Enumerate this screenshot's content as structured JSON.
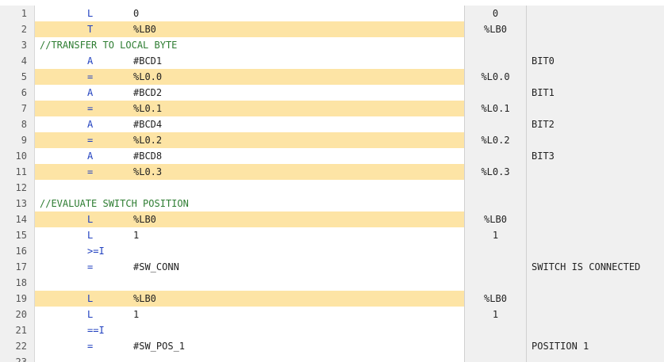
{
  "colors": {
    "keyword": "#1f3fbf",
    "number": "#3a6fd8",
    "comment": "#2e7d32",
    "highlight": "#fde4a5",
    "panel": "#f0f0f0"
  },
  "lines": [
    {
      "n": "1",
      "type": "code",
      "instr": "L",
      "operand": "0",
      "operandType": "num",
      "col2": "0",
      "col3": "",
      "hl": false
    },
    {
      "n": "2",
      "type": "code",
      "instr": "T",
      "operand": "%LB0",
      "operandType": "text",
      "col2": "%LB0",
      "col3": "",
      "hl": true
    },
    {
      "n": "3",
      "type": "comment",
      "text": "//TRANSFER TO LOCAL BYTE",
      "col2": "",
      "col3": "",
      "hl": false
    },
    {
      "n": "4",
      "type": "code",
      "instr": "A",
      "operand": "#BCD1",
      "operandType": "text",
      "col2": "",
      "col3": "BIT0",
      "hl": false
    },
    {
      "n": "5",
      "type": "code",
      "instr": "=",
      "operand": "%L0.0",
      "operandType": "text",
      "col2": "%L0.0",
      "col3": "",
      "hl": true
    },
    {
      "n": "6",
      "type": "code",
      "instr": "A",
      "operand": "#BCD2",
      "operandType": "text",
      "col2": "",
      "col3": "BIT1",
      "hl": false
    },
    {
      "n": "7",
      "type": "code",
      "instr": "=",
      "operand": "%L0.1",
      "operandType": "text",
      "col2": "%L0.1",
      "col3": "",
      "hl": true
    },
    {
      "n": "8",
      "type": "code",
      "instr": "A",
      "operand": "#BCD4",
      "operandType": "text",
      "col2": "",
      "col3": "BIT2",
      "hl": false
    },
    {
      "n": "9",
      "type": "code",
      "instr": "=",
      "operand": "%L0.2",
      "operandType": "text",
      "col2": "%L0.2",
      "col3": "",
      "hl": true
    },
    {
      "n": "10",
      "type": "code",
      "instr": "A",
      "operand": "#BCD8",
      "operandType": "text",
      "col2": "",
      "col3": "BIT3",
      "hl": false
    },
    {
      "n": "11",
      "type": "code",
      "instr": "=",
      "operand": "%L0.3",
      "operandType": "text",
      "col2": "%L0.3",
      "col3": "",
      "hl": true
    },
    {
      "n": "12",
      "type": "blank",
      "col2": "",
      "col3": "",
      "hl": false
    },
    {
      "n": "13",
      "type": "comment",
      "text": "//EVALUATE SWITCH POSITION",
      "col2": "",
      "col3": "",
      "hl": false
    },
    {
      "n": "14",
      "type": "code",
      "instr": "L",
      "operand": "%LB0",
      "operandType": "text",
      "col2": "%LB0",
      "col3": "",
      "hl": true
    },
    {
      "n": "15",
      "type": "code",
      "instr": "L",
      "operand": "1",
      "operandType": "num",
      "col2": "1",
      "col3": "",
      "hl": false
    },
    {
      "n": "16",
      "type": "code",
      "instr": ">=I",
      "operand": "",
      "operandType": "text",
      "col2": "",
      "col3": "",
      "hl": false
    },
    {
      "n": "17",
      "type": "code",
      "instr": "=",
      "operand": "#SW_CONN",
      "operandType": "text",
      "col2": "",
      "col3": "SWITCH IS CONNECTED",
      "hl": false
    },
    {
      "n": "18",
      "type": "blank",
      "col2": "",
      "col3": "",
      "hl": false
    },
    {
      "n": "19",
      "type": "code",
      "instr": "L",
      "operand": "%LB0",
      "operandType": "text",
      "col2": "%LB0",
      "col3": "",
      "hl": true
    },
    {
      "n": "20",
      "type": "code",
      "instr": "L",
      "operand": "1",
      "operandType": "num",
      "col2": "1",
      "col3": "",
      "hl": false
    },
    {
      "n": "21",
      "type": "code",
      "instr": "==I",
      "operand": "",
      "operandType": "text",
      "col2": "",
      "col3": "",
      "hl": false
    },
    {
      "n": "22",
      "type": "code",
      "instr": "=",
      "operand": "#SW_POS_1",
      "operandType": "text",
      "col2": "",
      "col3": "POSITION 1",
      "hl": false
    },
    {
      "n": "23",
      "type": "blank",
      "col2": "",
      "col3": "",
      "hl": false
    }
  ]
}
